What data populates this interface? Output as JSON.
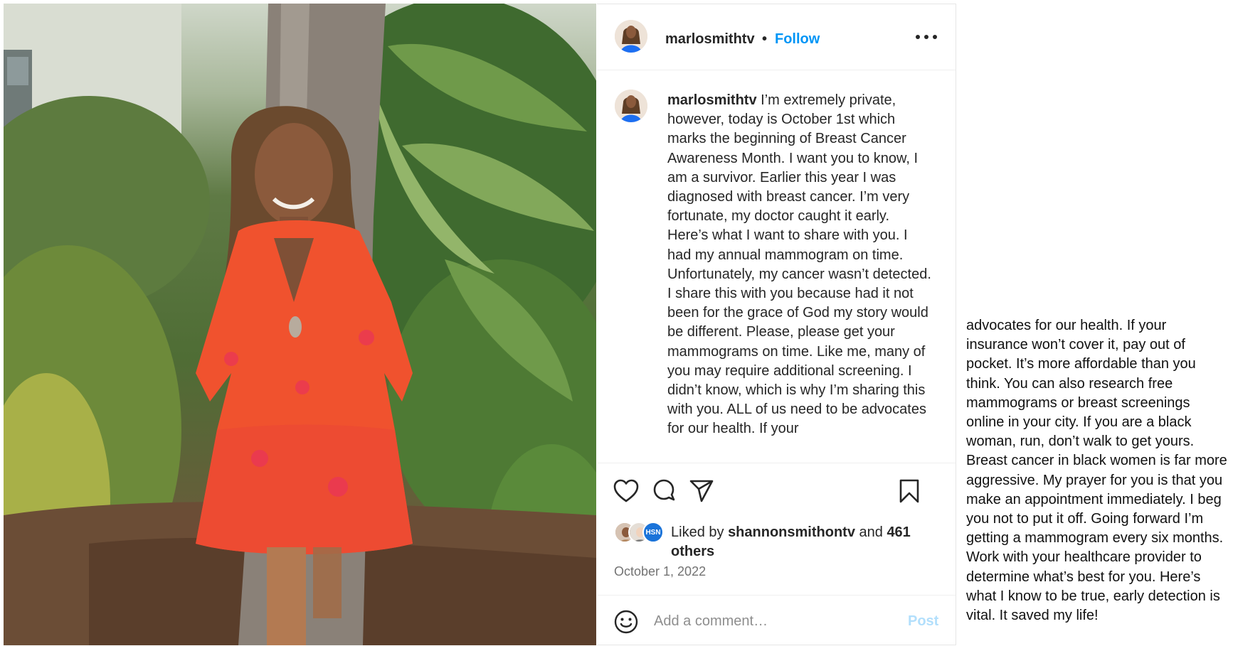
{
  "post": {
    "username": "marlosmithtv",
    "separator": "•",
    "follow_label": "Follow",
    "more_icon": "more-horizontal-icon",
    "caption_username": "marlosmithtv",
    "caption_text": "I’m extremely private, however, today is October 1st which marks the beginning of Breast Cancer Awareness Month. I want you to know, I am a survivor. Earlier this year I was diagnosed with breast cancer. I’m very fortunate, my doctor caught it early. Here’s what I want to share with you. I had my annual mammogram on time. Unfortunately, my cancer wasn’t detected. I share this with you because had it not been for the grace of God my story would be different. Please, please get your mammograms on time. Like me, many of you may require additional screening. I didn’t know, which is why I’m sharing this with you. ALL of us need to be advocates for our health. If your",
    "actions": {
      "like_icon": "heart-icon",
      "comment_icon": "comment-icon",
      "share_icon": "send-icon",
      "save_icon": "bookmark-icon"
    },
    "likes": {
      "prefix": "Liked by ",
      "user": "shannonsmithontv",
      "middle": " and ",
      "count": "461",
      "suffix": "others",
      "badge_text": "HSN"
    },
    "date": "October 1, 2022",
    "comment": {
      "emoji_icon": "emoji-icon",
      "placeholder": "Add a comment…",
      "post_label": "Post"
    }
  },
  "overflow_caption": "advocates for our health. If your insurance won’t cover it, pay out of pocket. It’s more affordable than you think. You can also research free mammograms or breast screenings online in your city. If you are a black woman, run, don’t walk to get yours. Breast cancer in black women is far more aggressive. My prayer for you is that you make an appointment immediately. I beg you not to put it off. Going forward I’m getting a mammogram every six months. Work with your healthcare provider to determine what’s best for you. Here’s what I know to be true, early detection is vital. It saved my life!",
  "colors": {
    "follow": "#0095f6",
    "post_disabled": "#b2dffc",
    "dress": "#f0522e",
    "foliage": "#4f6d35"
  }
}
